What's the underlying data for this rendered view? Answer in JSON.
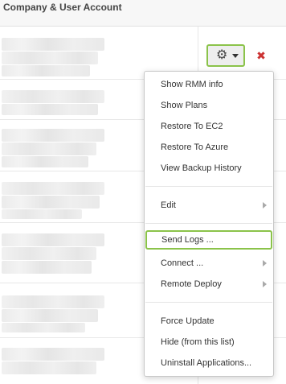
{
  "header": {
    "title": "Company & User Account"
  },
  "actions": {
    "gear_icon": "gear-icon",
    "delete_icon": "close-icon",
    "delete_glyph": "✖",
    "gear_glyph": "⚙"
  },
  "menu": {
    "group1": [
      "Show RMM info",
      "Show Plans",
      "Restore To EC2",
      "Restore To Azure",
      "View Backup History"
    ],
    "edit": "Edit",
    "send_logs": "Send Logs ...",
    "connect": "Connect ...",
    "remote_deploy": "Remote Deploy",
    "group4": [
      "Force Update",
      "Hide (from this list)",
      "Uninstall Applications..."
    ]
  },
  "colors": {
    "highlight": "#8bc34a",
    "delete": "#cc3333"
  }
}
